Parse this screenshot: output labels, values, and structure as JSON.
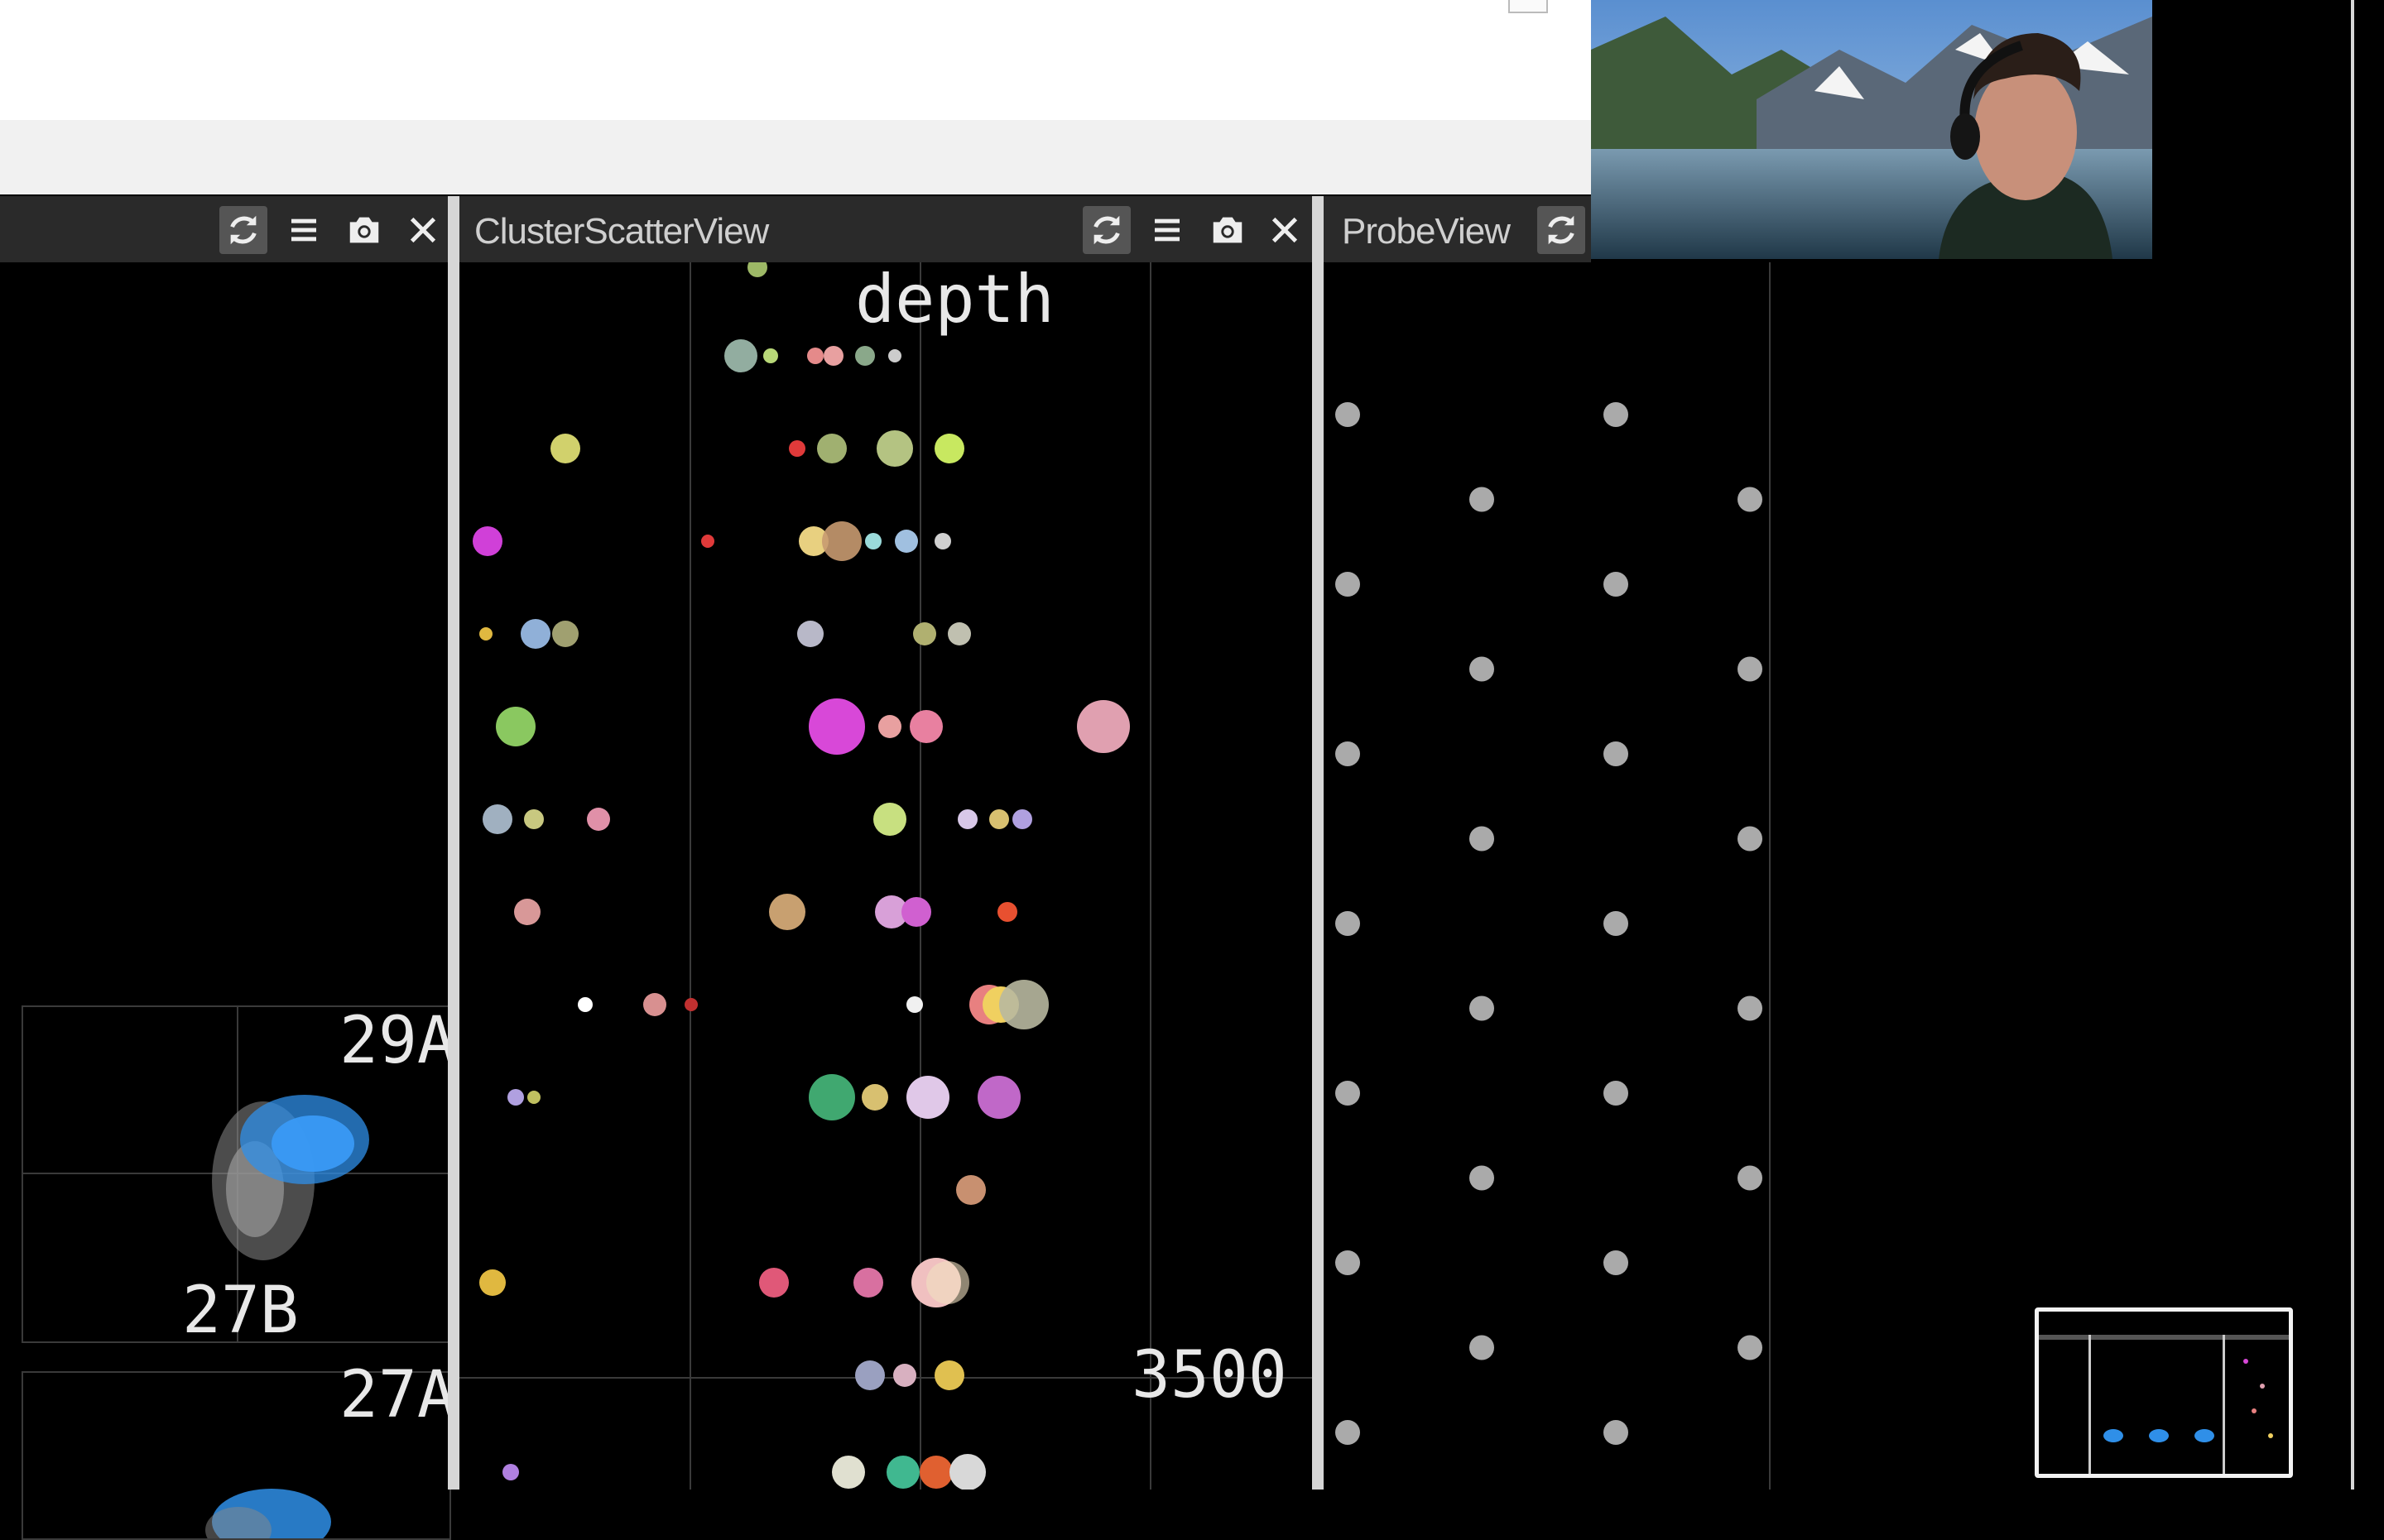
{
  "left_panel": {
    "toolbar_icons": [
      "refresh-icon",
      "menu-icon",
      "camera-icon",
      "close-icon"
    ],
    "features": [
      {
        "label_top": "29A",
        "label_bottom": "27B"
      },
      {
        "label_top": "27A"
      }
    ],
    "colors": {
      "cluster_a": "#2f8fe8",
      "cluster_b": "#8a8a8a"
    }
  },
  "cluster_scatter": {
    "title": "ClusterScatterView",
    "toolbar_icons": [
      "refresh-icon",
      "menu-icon",
      "camera-icon",
      "close-icon"
    ],
    "axis_label": "depth",
    "tick_label": "3500"
  },
  "probe_view": {
    "title": "ProbeView",
    "toolbar_icons": [
      "refresh-icon"
    ],
    "site_color": "#aaaaaa"
  },
  "webcam": {
    "icon": "webcam-feed"
  },
  "minimap": {
    "icon": "screen-thumbnail"
  }
}
